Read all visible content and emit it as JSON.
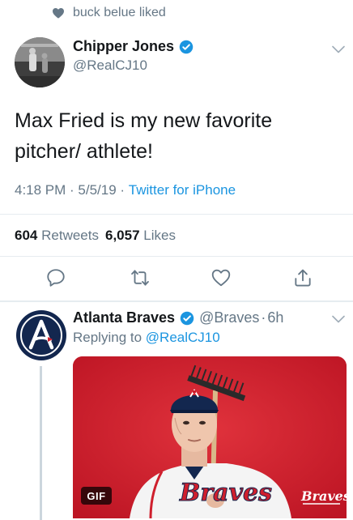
{
  "social_context": {
    "text": "buck belue liked",
    "icon": "heart-icon"
  },
  "tweet": {
    "author_name": "Chipper Jones",
    "author_handle": "@RealCJ10",
    "verified": true,
    "text": "Max Fried is my new favorite pitcher/ athlete!",
    "time": "4:18 PM",
    "date": "5/5/19",
    "separator": " · ",
    "source": "Twitter for iPhone",
    "retweets_count": "604",
    "retweets_label": "Retweets",
    "likes_count": "6,057",
    "likes_label": "Likes"
  },
  "actions": [
    "reply-icon",
    "retweet-icon",
    "like-icon",
    "share-icon"
  ],
  "reply": {
    "author_name": "Atlanta Braves",
    "author_handle": "@Braves",
    "separator": "·",
    "age": "6h",
    "verified": true,
    "replying_prefix": "Replying to",
    "replying_to": "@RealCJ10",
    "media_badge": "GIF",
    "media_wordmark": "Braves"
  },
  "colors": {
    "accent": "#1b95e0",
    "muted": "#657786",
    "divider": "#e6ecf0",
    "braves_navy": "#13274f",
    "media_red": "#cf1f2d"
  }
}
